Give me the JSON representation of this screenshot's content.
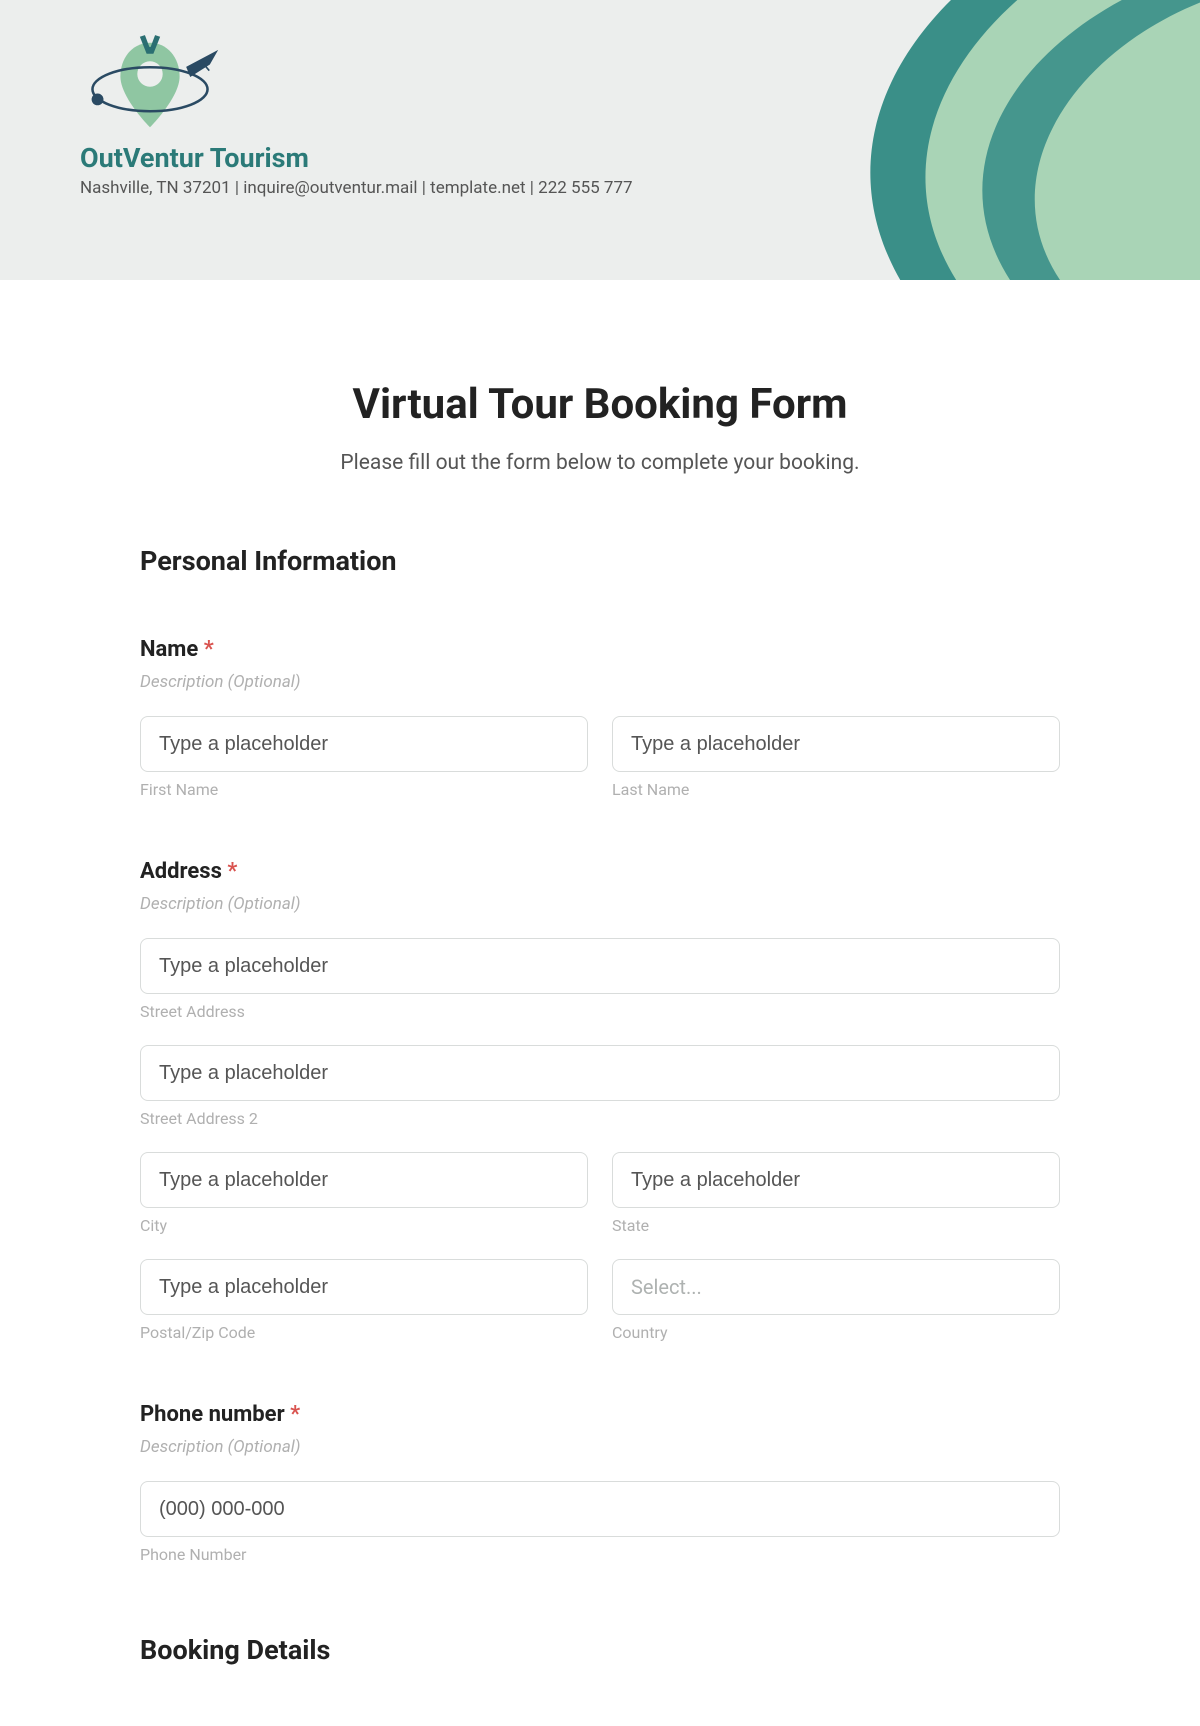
{
  "header": {
    "brand": "OutVentur Tourism",
    "subline": "Nashville, TN 37201 | inquire@outventur.mail | template.net | 222 555 777"
  },
  "form": {
    "title": "Virtual Tour Booking Form",
    "subtitle": "Please fill out the form below to complete your booking."
  },
  "sections": {
    "personal": "Personal Information",
    "booking": "Booking Details"
  },
  "name": {
    "label": "Name",
    "required": "*",
    "desc": "Description (Optional)",
    "first_placeholder": "Type a placeholder",
    "first_sub": "First Name",
    "last_placeholder": "Type a placeholder",
    "last_sub": "Last Name"
  },
  "address": {
    "label": "Address",
    "required": "*",
    "desc": "Description (Optional)",
    "street_placeholder": "Type a placeholder",
    "street_sub": "Street Address",
    "street2_placeholder": "Type a placeholder",
    "street2_sub": "Street Address 2",
    "city_placeholder": "Type a placeholder",
    "city_sub": "City",
    "state_placeholder": "Type a placeholder",
    "state_sub": "State",
    "postal_placeholder": "Type a placeholder",
    "postal_sub": "Postal/Zip Code",
    "country_placeholder": "Select...",
    "country_sub": "Country"
  },
  "phone": {
    "label": "Phone number",
    "required": "*",
    "desc": "Description (Optional)",
    "placeholder": "(000) 000-000",
    "sub": "Phone Number"
  }
}
